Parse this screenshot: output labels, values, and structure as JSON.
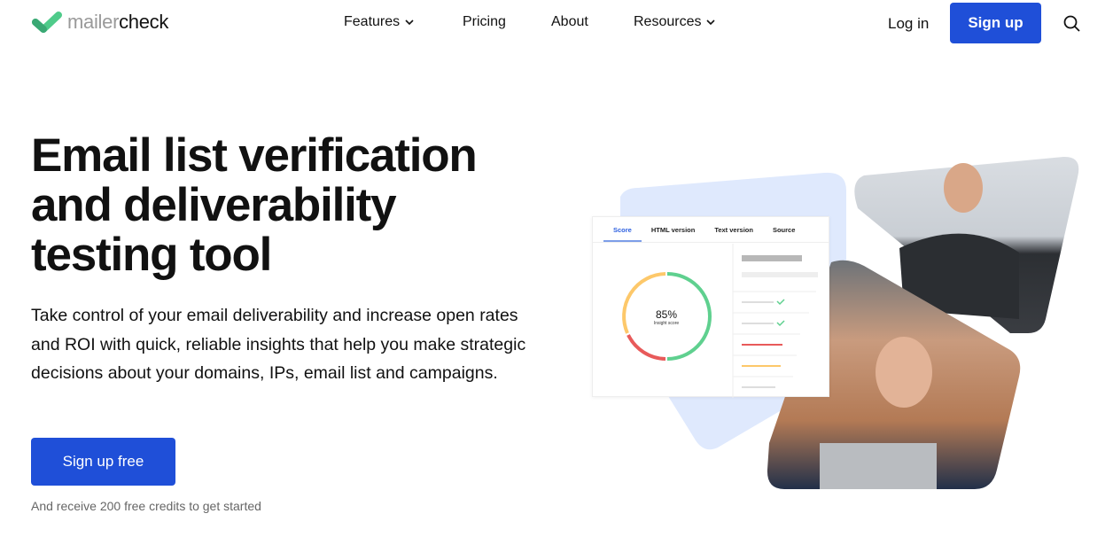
{
  "brand": {
    "name_light": "mailer",
    "name_dark": "check",
    "logo_color": "#4fcb8a"
  },
  "nav": {
    "items": [
      {
        "label": "Features",
        "dropdown": true
      },
      {
        "label": "Pricing"
      },
      {
        "label": "About"
      },
      {
        "label": "Resources",
        "dropdown": true
      }
    ],
    "login": "Log in",
    "signup": "Sign up",
    "search_icon": "search-icon"
  },
  "hero": {
    "title_lines": [
      "Email list verification",
      "and deliverability",
      "testing tool"
    ],
    "lead": "Take control of your email deliverability and increase open rates and ROI with quick, reliable insights that help you make strategic decisions about your domains, IPs, email list and campaigns.",
    "cta": "Sign up free",
    "note": "And receive 200 free credits to get started"
  },
  "card": {
    "tabs": [
      "Score",
      "HTML version",
      "Text version",
      "Source"
    ],
    "active_tab": "Score",
    "score_value": "85%",
    "score_label": "Insight score",
    "score_percent": 85
  },
  "colors": {
    "accent": "#1f4fd8",
    "green": "#5fd08f",
    "yellow": "#fdc86a",
    "red": "#e85a5a",
    "blob": "#dfe9fd"
  }
}
